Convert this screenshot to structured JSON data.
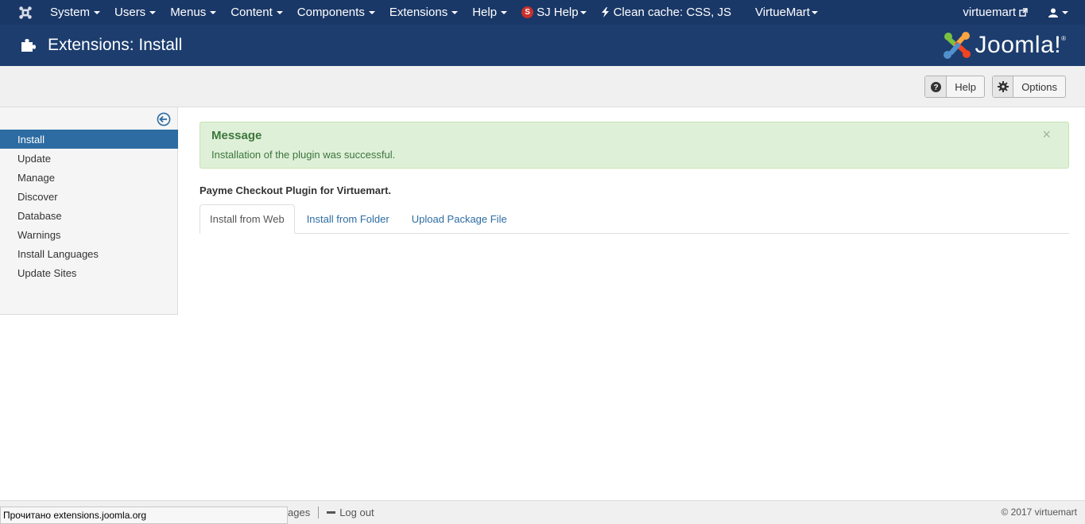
{
  "navbar": {
    "menus": [
      {
        "label": "System"
      },
      {
        "label": "Users"
      },
      {
        "label": "Menus"
      },
      {
        "label": "Content"
      },
      {
        "label": "Components"
      },
      {
        "label": "Extensions"
      },
      {
        "label": "Help"
      }
    ],
    "sj_badge": "S",
    "sj_help": "SJ Help",
    "clean_cache": "Clean cache: CSS, JS",
    "virtuemart": "VirtueMart",
    "site_link": "virtuemart"
  },
  "header": {
    "title": "Extensions: Install",
    "logo_text": "Joomla!",
    "logo_reg": "®"
  },
  "toolbar": {
    "help_label": "Help",
    "options_label": "Options"
  },
  "sidebar": {
    "items": [
      {
        "label": "Install"
      },
      {
        "label": "Update"
      },
      {
        "label": "Manage"
      },
      {
        "label": "Discover"
      },
      {
        "label": "Database"
      },
      {
        "label": "Warnings"
      },
      {
        "label": "Install Languages"
      },
      {
        "label": "Update Sites"
      }
    ],
    "active_index": 0
  },
  "message": {
    "title": "Message",
    "text": "Installation of the plugin was successful.",
    "close": "×"
  },
  "main": {
    "plugin_title": "Payme Checkout Plugin for Virtuemart.",
    "tabs": [
      {
        "label": "Install from Web"
      },
      {
        "label": "Install from Folder"
      },
      {
        "label": "Upload Package File"
      }
    ]
  },
  "footer": {
    "messages_fragment": "ages",
    "logout": "Log out",
    "copyright": "© 2017 virtuemart"
  },
  "statusbar": {
    "text": "Прочитано extensions.joomla.org"
  },
  "colors": {
    "navbar": "#1a3867",
    "header": "#1c3d6e",
    "active_sidebar": "#2d6ca2",
    "alert_bg": "#dff0d8",
    "alert_text": "#3c763d"
  }
}
